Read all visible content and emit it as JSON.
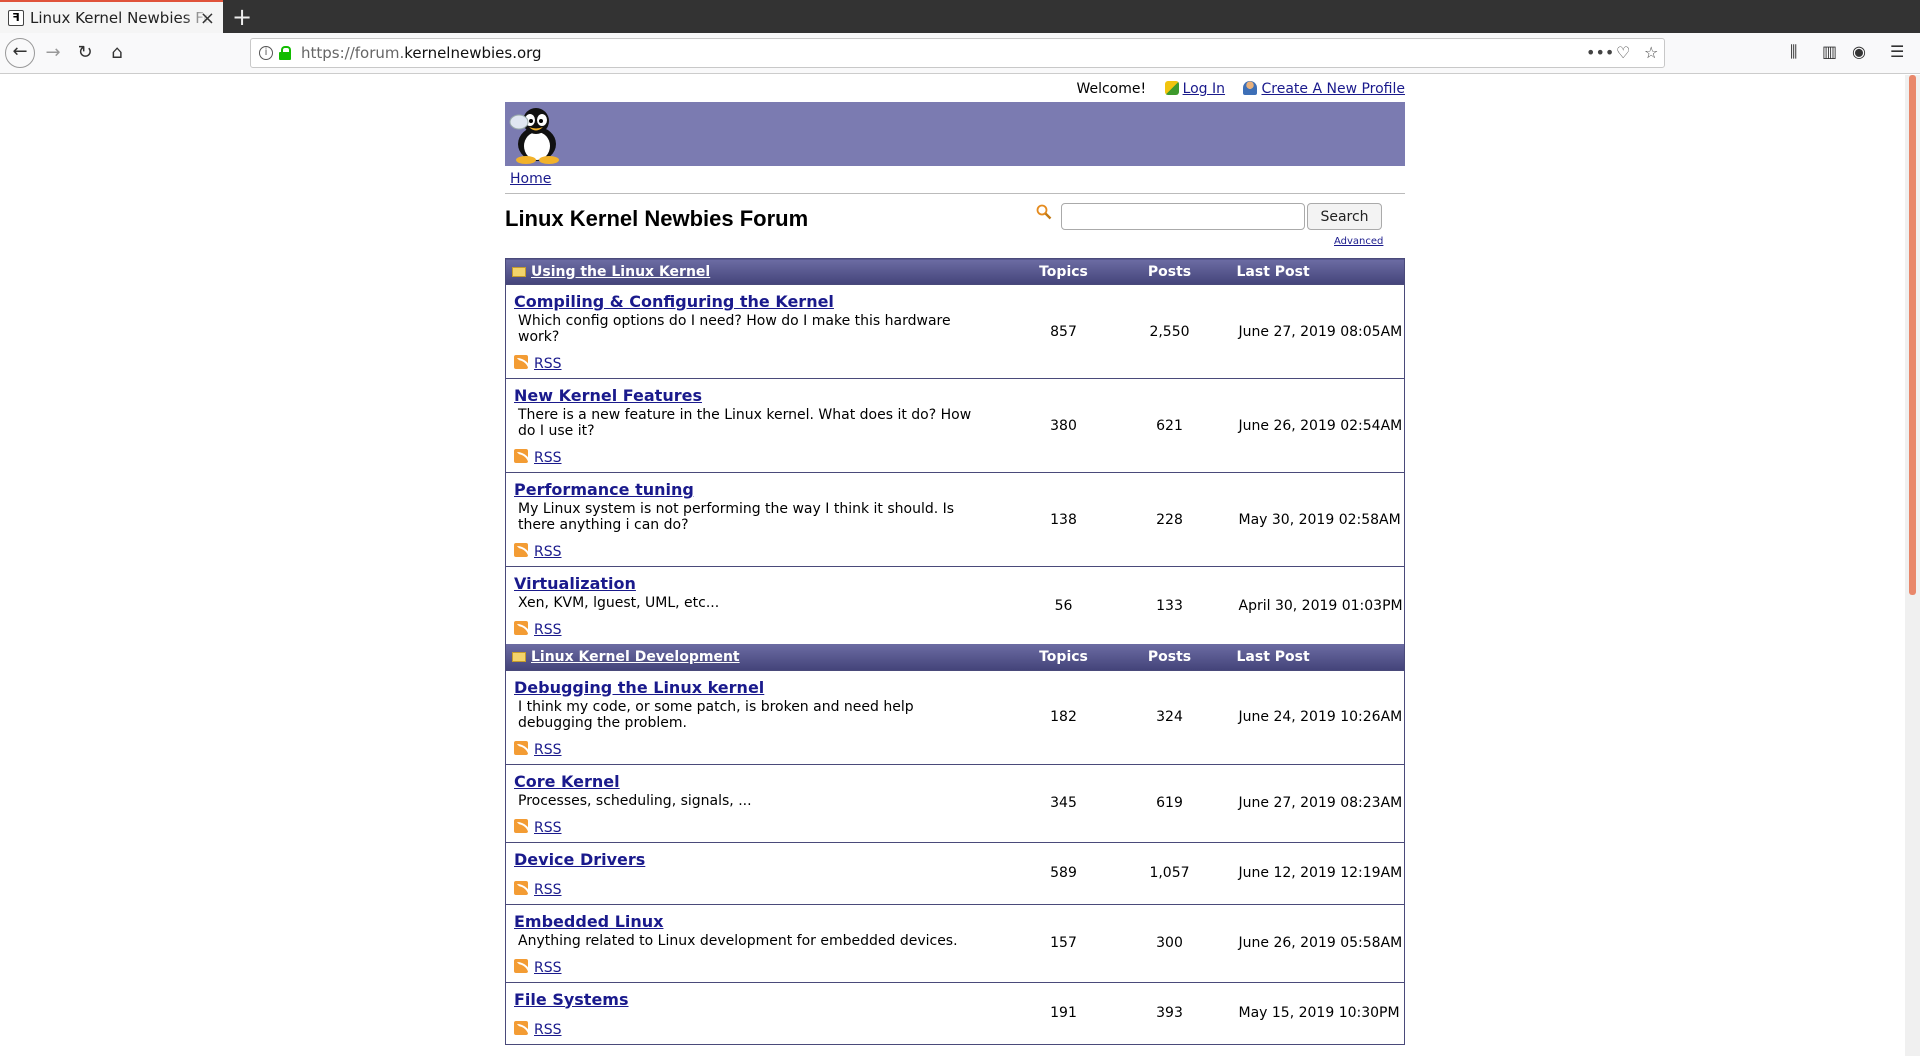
{
  "browser": {
    "tab_title": "Linux Kernel Newbies Forum",
    "tab_favicon": "forum-favicon",
    "url_prefix": "https://forum.",
    "url_domain": "kernelnewbies.org",
    "accent_color": "#e0533a"
  },
  "toplinks": {
    "welcome": "Welcome!",
    "login": "Log In",
    "create_profile": "Create A New Profile"
  },
  "breadcrumb": {
    "home": "Home"
  },
  "forum": {
    "title": "Linux Kernel Newbies Forum",
    "search_button": "Search",
    "search_value": "",
    "advanced": "Advanced"
  },
  "colors": {
    "banner": "#7b7bb1",
    "header": "#44447a",
    "link": "#1a1a8c"
  },
  "categories": [
    {
      "name": "Using the Linux Kernel",
      "col_topics": "Topics",
      "col_posts": "Posts",
      "col_last": "Last Post",
      "forums": [
        {
          "name": "Compiling & Configuring the Kernel",
          "desc": "Which config options do I need? How do I make this hardware work?",
          "topics": "857",
          "posts": "2,550",
          "last": "June 27, 2019 08:05AM",
          "rss": "RSS"
        },
        {
          "name": "New Kernel Features",
          "desc": "There is a new feature in the Linux kernel. What does it do? How do I use it?",
          "topics": "380",
          "posts": "621",
          "last": "June 26, 2019 02:54AM",
          "rss": "RSS"
        },
        {
          "name": "Performance tuning",
          "desc": "My Linux system is not performing the way I think it should. Is there anything i can do?",
          "topics": "138",
          "posts": "228",
          "last": "May 30, 2019 02:58AM",
          "rss": "RSS"
        },
        {
          "name": "Virtualization",
          "desc": "Xen, KVM, lguest, UML, etc...",
          "topics": "56",
          "posts": "133",
          "last": "April 30, 2019 01:03PM",
          "rss": "RSS"
        }
      ]
    },
    {
      "name": "Linux Kernel Development",
      "col_topics": "Topics",
      "col_posts": "Posts",
      "col_last": "Last Post",
      "forums": [
        {
          "name": "Debugging the Linux kernel",
          "desc": "I think my code, or some patch, is broken and need help debugging the problem.",
          "topics": "182",
          "posts": "324",
          "last": "June 24, 2019 10:26AM",
          "rss": "RSS"
        },
        {
          "name": "Core Kernel",
          "desc": "Processes, scheduling, signals, ...",
          "topics": "345",
          "posts": "619",
          "last": "June 27, 2019 08:23AM",
          "rss": "RSS"
        },
        {
          "name": "Device Drivers",
          "desc": "",
          "topics": "589",
          "posts": "1,057",
          "last": "June 12, 2019 12:19AM",
          "rss": "RSS"
        },
        {
          "name": "Embedded Linux",
          "desc": "Anything related to Linux development for embedded devices.",
          "topics": "157",
          "posts": "300",
          "last": "June 26, 2019 05:58AM",
          "rss": "RSS"
        },
        {
          "name": "File Systems",
          "desc": "",
          "topics": "191",
          "posts": "393",
          "last": "May 15, 2019 10:30PM",
          "rss": "RSS"
        }
      ]
    }
  ]
}
